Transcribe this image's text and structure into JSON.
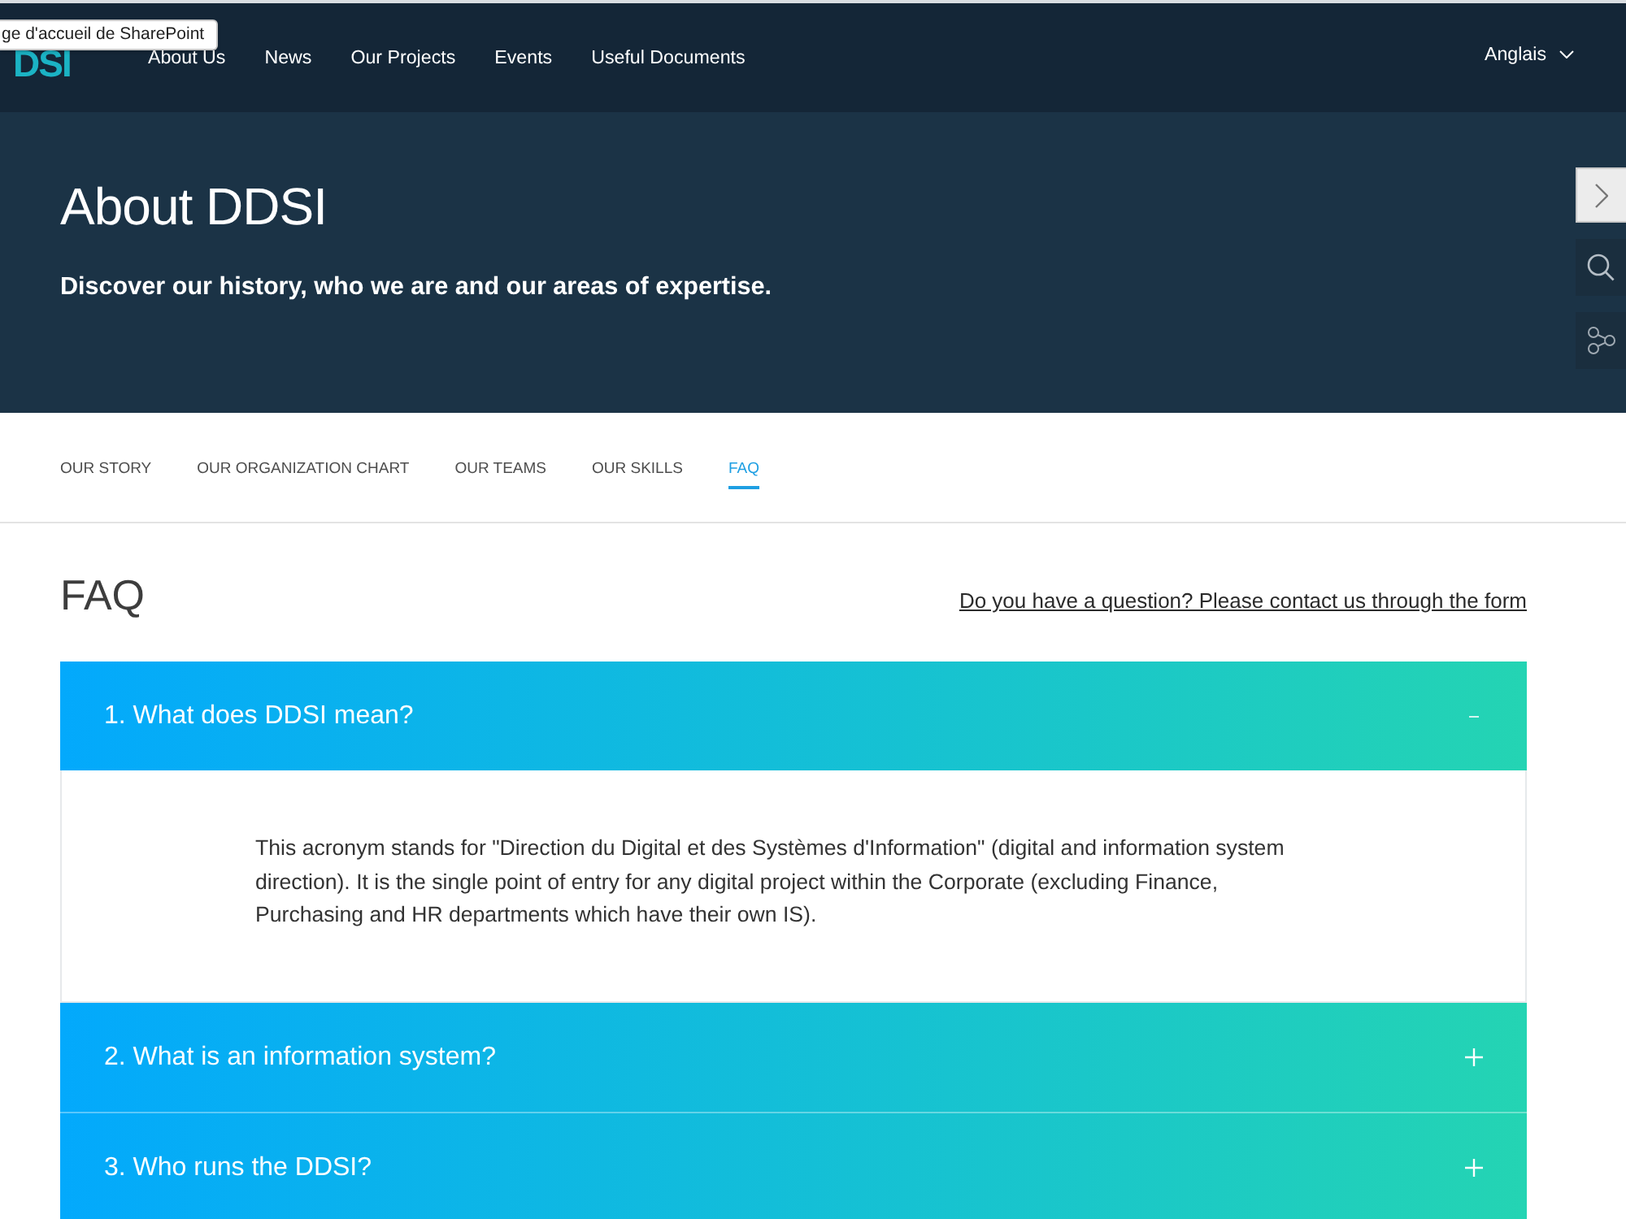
{
  "tooltip": {
    "text": "ge d'accueil de SharePoint"
  },
  "header": {
    "logo": "DSI",
    "nav": [
      {
        "label": "About Us"
      },
      {
        "label": "News"
      },
      {
        "label": "Our Projects"
      },
      {
        "label": "Events"
      },
      {
        "label": "Useful Documents"
      }
    ],
    "language": "Anglais"
  },
  "hero": {
    "title": "About DDSI",
    "subtitle": "Discover our history, who we are and our areas of expertise."
  },
  "tabs": [
    {
      "label": "OUR STORY",
      "selected": false
    },
    {
      "label": "OUR ORGANIZATION CHART",
      "selected": false
    },
    {
      "label": "OUR TEAMS",
      "selected": false
    },
    {
      "label": "OUR SKILLS",
      "selected": false
    },
    {
      "label": "FAQ",
      "selected": true
    }
  ],
  "faq": {
    "title": "FAQ",
    "contact_link": "Do you have a question? Please contact us through the form",
    "items": [
      {
        "question": "1. What does DDSI mean?",
        "expanded": true,
        "answer": "This acronym stands for \"Direction du Digital et des Systèmes d'Information\" (digital and information system direction). It is the single point of entry for any digital project within the Corporate (excluding Finance, Purchasing and HR departments which have their own IS)."
      },
      {
        "question": "2. What is an information system?",
        "expanded": false
      },
      {
        "question": "3. Who runs the DDSI?",
        "expanded": false
      }
    ]
  }
}
